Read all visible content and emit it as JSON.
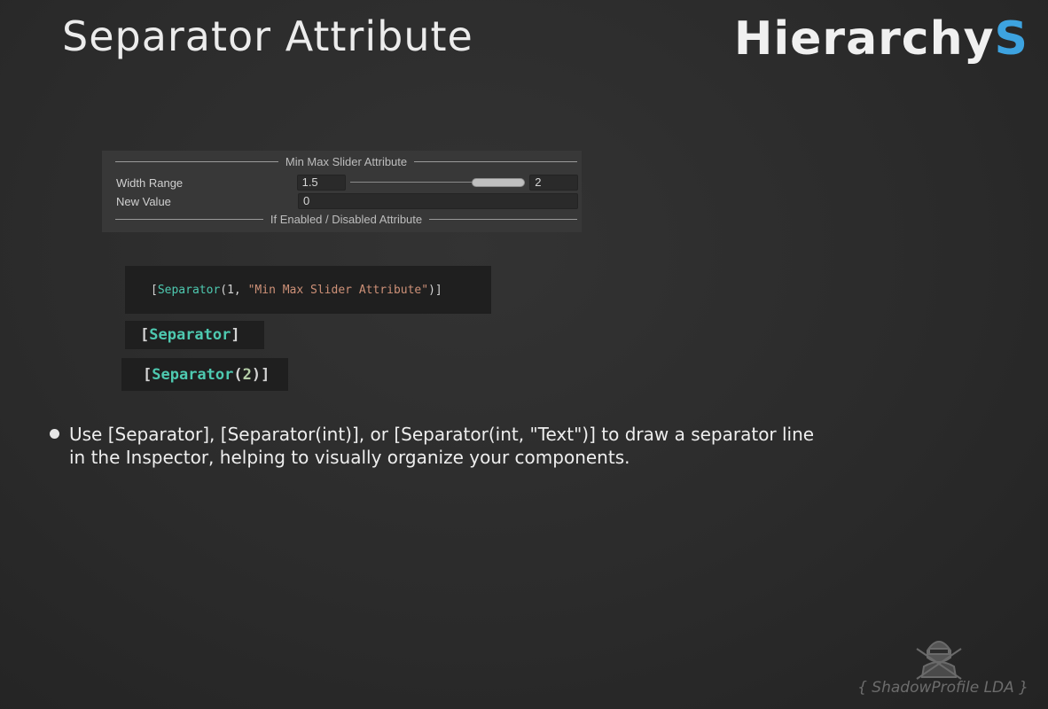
{
  "header": {
    "title": "Separator Attribute",
    "brand_main": "Hierarchy",
    "brand_accent": "S"
  },
  "colors": {
    "accent": "#3da3e0",
    "code_keyword": "#4ec9b0",
    "code_string": "#ce9178"
  },
  "inspector": {
    "separator_top": "Min Max Slider Attribute",
    "fields": [
      {
        "label": "Width Range",
        "min": "1.5",
        "max": "2"
      },
      {
        "label": "New Value",
        "value": "0"
      }
    ],
    "separator_bottom": "If Enabled / Disabled Attribute"
  },
  "code_snippets": {
    "snippet1": {
      "open": "[",
      "kw": "Separator",
      "paren": "(1, ",
      "str": "\"Min Max Slider Attribute\"",
      "close": ")]"
    },
    "snippet2": {
      "open": "[",
      "kw": "Separator",
      "close": "]"
    },
    "snippet3": {
      "open": "[",
      "kw": "Separator",
      "paren": "(",
      "num": "2",
      "close": ")]"
    }
  },
  "description": {
    "line1": "Use [Separator], [Separator(int)], or [Separator(int, \"Text\")] to draw a separator line",
    "line2": "in the Inspector, helping to visually organize your components."
  },
  "footer": {
    "credit": "{ ShadowProfile LDA }",
    "logo_icon": "ninja-icon"
  }
}
